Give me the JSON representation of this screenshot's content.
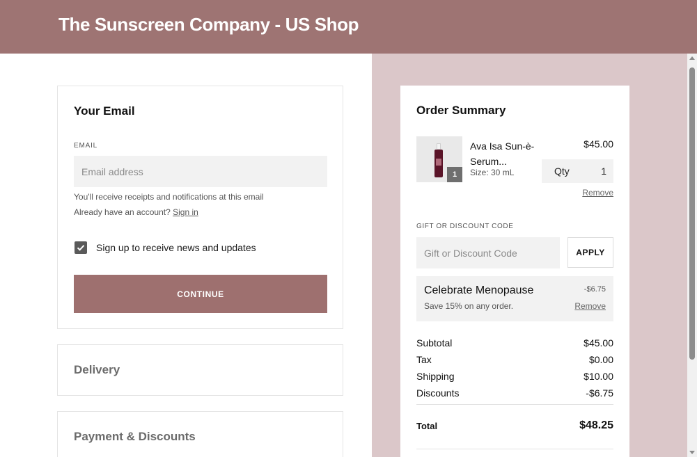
{
  "header": {
    "title": "The Sunscreen Company - US Shop"
  },
  "email_section": {
    "title": "Your Email",
    "field_label": "EMAIL",
    "placeholder": "Email address",
    "helper_text": "You'll receive receipts and notifications at this email",
    "account_prompt": "Already have an account?",
    "sign_in_label": "Sign in",
    "newsletter_label": "Sign up to receive news and updates",
    "newsletter_checked": true,
    "continue_label": "CONTINUE"
  },
  "collapsed_sections": {
    "delivery": "Delivery",
    "payment": "Payment & Discounts"
  },
  "order_summary": {
    "title": "Order Summary",
    "item": {
      "name": "Ava Isa Sun-è-Serum...",
      "size": "Size: 30 mL",
      "price": "$45.00",
      "quantity_badge": "1",
      "qty_label": "Qty",
      "qty_value": "1",
      "remove_label": "Remove"
    },
    "discount_code": {
      "label": "GIFT OR DISCOUNT CODE",
      "placeholder": "Gift or Discount Code",
      "apply_label": "APPLY"
    },
    "applied_promo": {
      "name": "Celebrate Menopause",
      "description": "Save 15% on any order.",
      "amount": "-$6.75",
      "remove_label": "Remove"
    },
    "totals": [
      {
        "label": "Subtotal",
        "value": "$45.00"
      },
      {
        "label": "Tax",
        "value": "$0.00"
      },
      {
        "label": "Shipping",
        "value": "$10.00"
      },
      {
        "label": "Discounts",
        "value": "-$6.75"
      }
    ],
    "grand_total": {
      "label": "Total",
      "value": "$48.25"
    }
  },
  "colors": {
    "header_bg": "#9e7473",
    "sidebar_bg": "#dbc7c9",
    "button_bg": "#9e706f"
  }
}
